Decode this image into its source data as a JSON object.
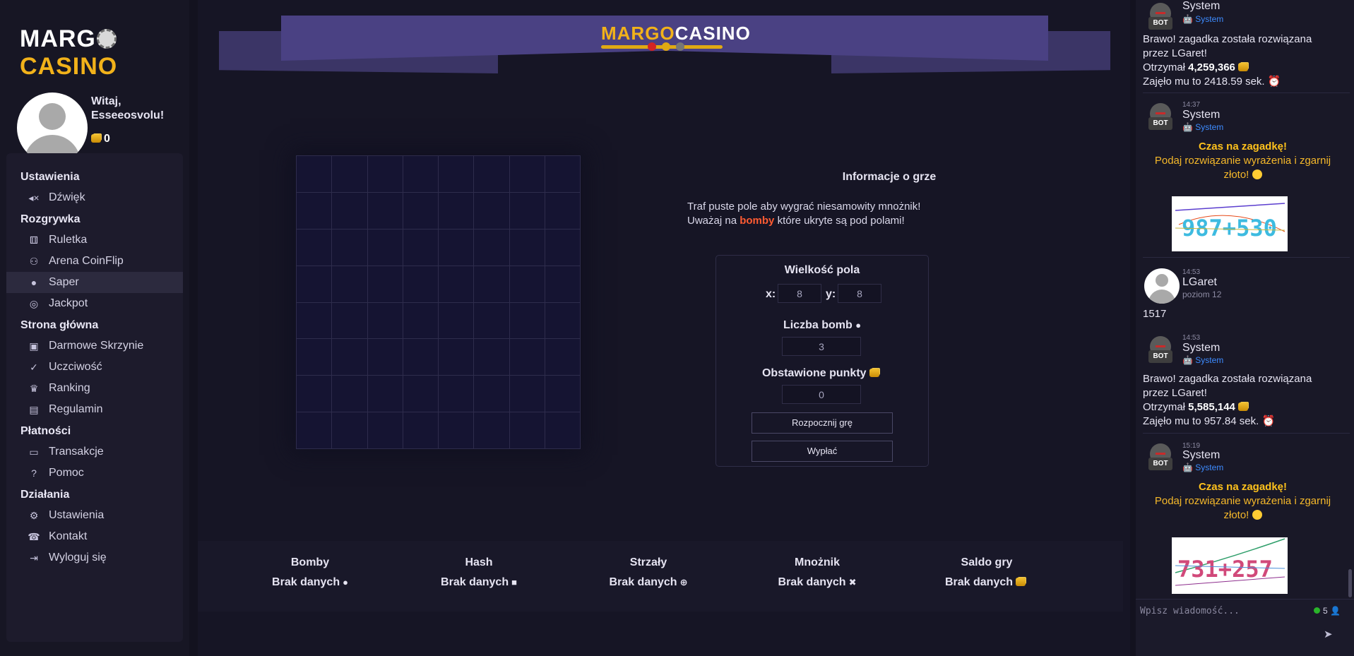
{
  "brand": {
    "word1": "MARG",
    "word2": "CASINO",
    "banner_part1": "MARGO",
    "banner_part2": "CASINO"
  },
  "user": {
    "greeting_line1": "Witaj,",
    "greeting_line2": "Esseeosvolu!",
    "balance": "0"
  },
  "menu": [
    {
      "section": "Ustawienia",
      "items": [
        {
          "label": "Dźwięk",
          "icon": "volume-mute-icon"
        }
      ]
    },
    {
      "section": "Rozgrywka",
      "items": [
        {
          "label": "Ruletka",
          "icon": "dice-icon"
        },
        {
          "label": "Arena CoinFlip",
          "icon": "users-arena-icon"
        },
        {
          "label": "Saper",
          "icon": "bomb-icon",
          "active": true
        },
        {
          "label": "Jackpot",
          "icon": "target-icon"
        }
      ]
    },
    {
      "section": "Strona główna",
      "items": [
        {
          "label": "Darmowe Skrzynie",
          "icon": "briefcase-icon"
        },
        {
          "label": "Uczciwość",
          "icon": "clipboard-check-icon"
        },
        {
          "label": "Ranking",
          "icon": "trophy-icon"
        },
        {
          "label": "Regulamin",
          "icon": "book-icon"
        }
      ]
    },
    {
      "section": "Płatności",
      "items": [
        {
          "label": "Transakcje",
          "icon": "wallet-icon"
        },
        {
          "label": "Pomoc",
          "icon": "question-icon"
        }
      ]
    },
    {
      "section": "Działania",
      "items": [
        {
          "label": "Ustawienia",
          "icon": "user-cog-icon"
        },
        {
          "label": "Kontakt",
          "icon": "address-book-icon"
        },
        {
          "label": "Wyloguj się",
          "icon": "sign-out-icon"
        }
      ]
    }
  ],
  "game": {
    "info_title": "Informacje o grze",
    "info_line1": "Traf puste pole aby wygrać niesamowity mnożnik!",
    "info_line2_pre": "Uważaj na",
    "info_line2_red": "bomby",
    "info_line2_post": "które ukryte są pod polami!",
    "grid_size_label": "Wielkość pola",
    "x_label": "x:",
    "y_label": "y:",
    "x_value": "8",
    "y_value": "8",
    "bombs_label": "Liczba bomb",
    "bombs_value": "3",
    "bet_label": "Obstawione punkty",
    "bet_value": "0",
    "start_button": "Rozpocznij grę",
    "cashout_button": "Wypłać",
    "grid_cols": 8,
    "grid_rows": 8
  },
  "stats": [
    {
      "title": "Bomby",
      "value": "Brak danych",
      "icon": "bomb-icon",
      "glyph": "●"
    },
    {
      "title": "Hash",
      "value": "Brak danych",
      "icon": "lock-icon",
      "glyph": "🔒"
    },
    {
      "title": "Strzały",
      "value": "Brak danych",
      "icon": "crosshair-icon",
      "glyph": "⌖"
    },
    {
      "title": "Mnożnik",
      "value": "Brak danych",
      "icon": "times-icon",
      "glyph": "✖"
    },
    {
      "title": "Saldo gry",
      "value": "Brak danych",
      "icon": "coins-icon",
      "glyph": ""
    }
  ],
  "chat": {
    "messages": [
      {
        "name": "System",
        "badge": "🤖 System",
        "line1": "Brawo! zagadka została rozwiązana",
        "line2": "przez LGaret!",
        "received_pre": "Otrzymał",
        "received_amount": "4,259,366",
        "time_pre": "Zajęło mu to 2418.59 sek."
      },
      {
        "time": "14:37",
        "name": "System",
        "badge": "🤖 System",
        "riddle_title": "Czas na zagadkę!",
        "riddle_line1": "Podaj rozwiązanie wyrażenia i zgarnij",
        "riddle_line2": "złoto!",
        "captcha": "987+530"
      },
      {
        "time": "14:53",
        "name": "LGaret",
        "level": "poziom 12",
        "text": "1517"
      },
      {
        "time": "14:53",
        "name": "System",
        "badge": "🤖 System",
        "line1": "Brawo! zagadka została rozwiązana",
        "line2": "przez LGaret!",
        "received_pre": "Otrzymał",
        "received_amount": "5,585,144",
        "time_pre": "Zajęło mu to 957.84 sek."
      },
      {
        "time": "15:19",
        "name": "System",
        "badge": "🤖 System",
        "riddle_title": "Czas na zagadkę!",
        "riddle_line1": "Podaj rozwiązanie wyrażenia i zgarnij",
        "riddle_line2": "złoto!",
        "captcha": "731+257"
      }
    ],
    "bot_tag": "BOT",
    "input_placeholder": "Wpisz wiadomość...",
    "online_count": "5"
  },
  "colors": {
    "accent_gold": "#f2b21a",
    "bomb_red": "#ff5b32",
    "system_blue": "#3d8bff",
    "riddle_gold": "#ffc21c"
  }
}
